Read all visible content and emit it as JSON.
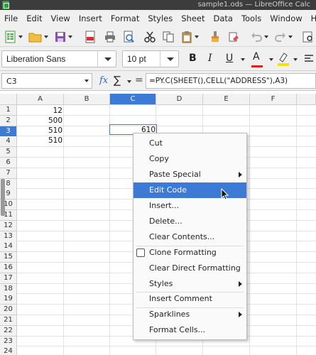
{
  "window": {
    "title": "sample1.ods — LibreOffice Calc"
  },
  "menu": [
    "File",
    "Edit",
    "View",
    "Insert",
    "Format",
    "Styles",
    "Sheet",
    "Data",
    "Tools",
    "Window",
    "Help"
  ],
  "toolbar": {
    "font_name": "Liberation Sans",
    "font_size": "10 pt",
    "bold": "B",
    "italic": "I",
    "underline": "U",
    "font_color": "A",
    "accent_colors": {
      "font_color": "#e02020",
      "highlight": "#f5e000",
      "active": "#3d7ad6"
    }
  },
  "formula_bar": {
    "name_box": "C3",
    "fx": "fx",
    "sigma": "∑",
    "equals": "=",
    "formula": "=PY.C(SHEET(),CELL(\"ADDRESS\"),A3)"
  },
  "sheet": {
    "columns": [
      "A",
      "B",
      "C",
      "D",
      "E",
      "F"
    ],
    "active_column": "C",
    "rows": [
      "1",
      "2",
      "3",
      "4",
      "5",
      "6",
      "7",
      "8",
      "9",
      "10",
      "11",
      "12",
      "13",
      "14",
      "15",
      "16",
      "17",
      "18",
      "19",
      "20",
      "21",
      "22",
      "23",
      "24"
    ],
    "active_row": "3",
    "cells": {
      "A1": "12",
      "A2": "500",
      "A3": "510",
      "A4": "510",
      "C3": "610"
    }
  },
  "context_menu": {
    "items": [
      {
        "label": "Cut"
      },
      {
        "label": "Copy"
      },
      {
        "label": "Paste Special"
      },
      {
        "label": "Edit Code"
      },
      {
        "label": "Insert..."
      },
      {
        "label": "Delete..."
      },
      {
        "label": "Clear Contents..."
      },
      {
        "label": "Clone Formatting"
      },
      {
        "label": "Clear Direct Formatting"
      },
      {
        "label": "Styles"
      },
      {
        "label": "Insert Comment"
      },
      {
        "label": "Sparklines"
      },
      {
        "label": "Format Cells..."
      }
    ],
    "highlighted": "Edit Code"
  }
}
